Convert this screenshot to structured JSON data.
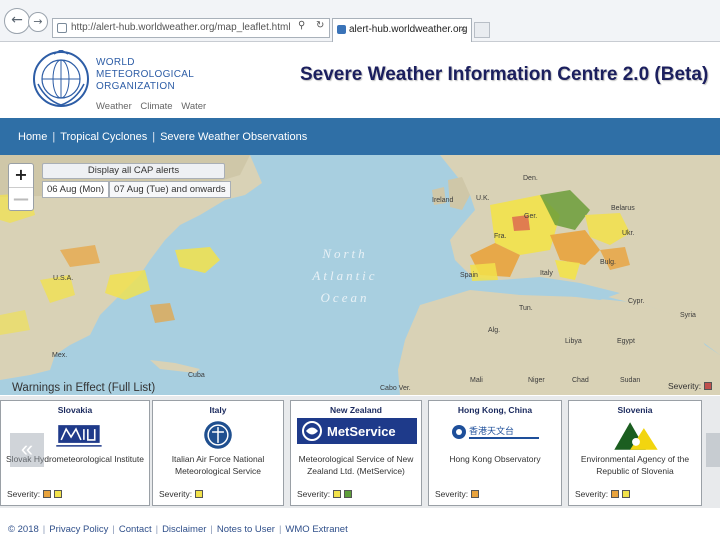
{
  "browser": {
    "url": "http://alert-hub.worldweather.org/map_leaflet.html",
    "tab_title": "alert-hub.worldweather.org",
    "search_icon": "search-icon",
    "refresh_icon": "refresh-icon"
  },
  "header": {
    "org_lines": [
      "WORLD",
      "METEOROLOGICAL",
      "ORGANIZATION"
    ],
    "tagline": [
      "Weather",
      "Climate",
      "Water"
    ],
    "title": "Severe Weather Information Centre 2.0 (Beta)"
  },
  "nav": {
    "items": [
      "Home",
      "Tropical Cyclones",
      "Severe Weather Observations"
    ]
  },
  "map": {
    "zoom_in": "+",
    "zoom_out": "—",
    "alerts_button": "Display all CAP alerts",
    "dates": [
      "06 Aug (Mon)",
      "07 Aug (Tue) and onwards"
    ],
    "ocean_label": [
      "North",
      "Atlantic",
      "Ocean"
    ],
    "place_labels": [
      "U.S.A.",
      "Mex.",
      "Cuba",
      "Ireland",
      "U.K.",
      "Fra.",
      "Spain",
      "Den.",
      "Ger.",
      "Belarus",
      "Ukr.",
      "Bulg.",
      "Italy",
      "Tun.",
      "Alg.",
      "Libya",
      "Egypt",
      "Cypr.",
      "Syria",
      "Mali",
      "Niger",
      "Chad",
      "Sudan",
      "Cabo Ver."
    ],
    "severity_colors": {
      "red": "#d9534f",
      "orange": "#e8a33d",
      "yellow": "#f2e24a",
      "green": "#6b9e3a"
    }
  },
  "warnings": {
    "title": "Warnings in Effect (Full List)",
    "severity_label": "Severity:",
    "severity_color": "#c0504d",
    "prev_arrow": "«",
    "cards": [
      {
        "country": "Slovakia",
        "org": "Slovak Hydrometeorological Institute",
        "severity_colors": [
          "#e8a33d",
          "#f2e24a"
        ]
      },
      {
        "country": "Italy",
        "org": "Italian Air Force National Meteorological Service",
        "severity_colors": [
          "#f2e24a"
        ]
      },
      {
        "country": "New Zealand",
        "org": "Meteorological Service of New Zealand Ltd. (MetService)",
        "logo_text": "MetService",
        "severity_colors": [
          "#f2e24a",
          "#5e9e3a"
        ]
      },
      {
        "country": "Hong Kong, China",
        "org": "Hong Kong Observatory",
        "logo_text": "香港天文台",
        "severity_colors": [
          "#e8a33d"
        ]
      },
      {
        "country": "Slovenia",
        "org": "Environmental Agency of the Republic of Slovenia",
        "severity_colors": [
          "#e8a33d",
          "#f2e24a"
        ]
      }
    ],
    "card_severity_label": "Severity:"
  },
  "footer": {
    "copyright": "© 2018",
    "links": [
      "Privacy Policy",
      "Contact",
      "Disclaimer",
      "Notes to User",
      "WMO Extranet"
    ]
  }
}
